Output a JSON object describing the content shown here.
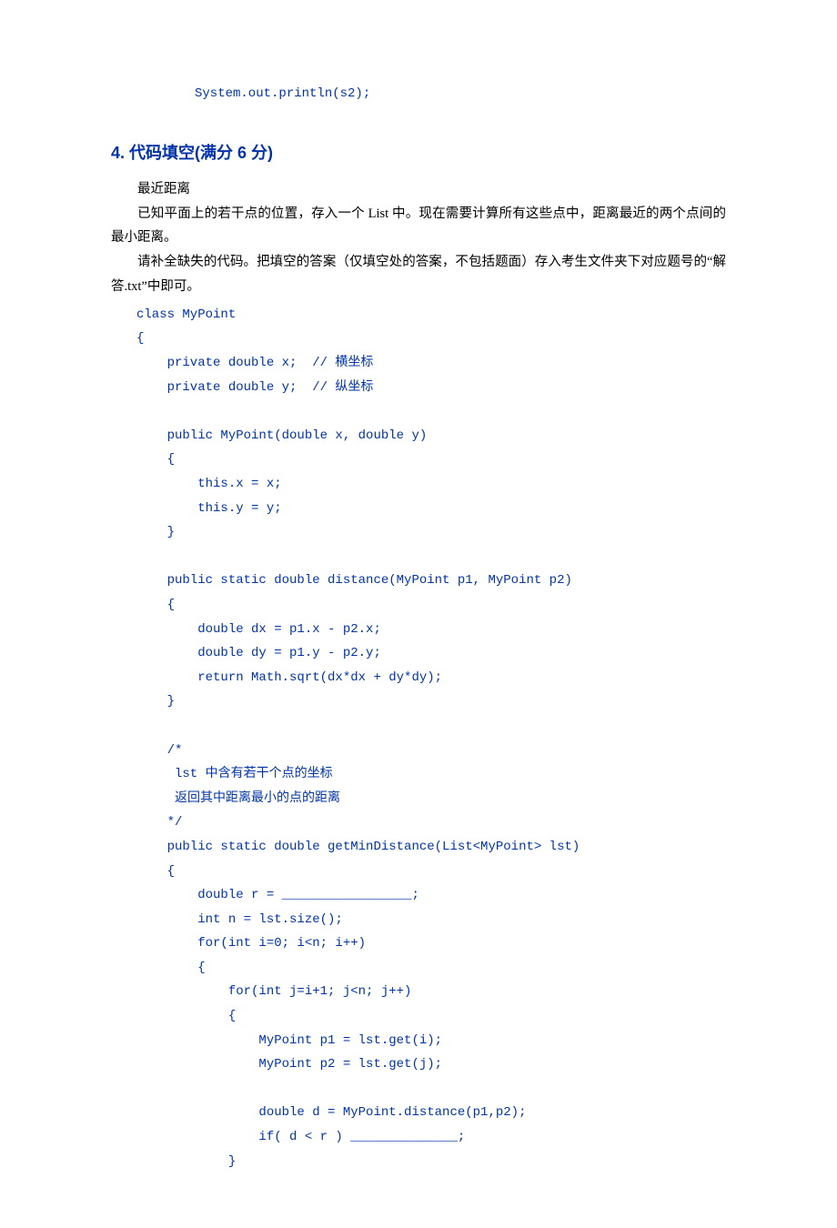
{
  "top_code_line": "System.out.println(s2);",
  "heading": "4. 代码填空(满分 6 分)",
  "para_title": "最近距离",
  "para1": "已知平面上的若干点的位置，存入一个 List 中。现在需要计算所有这些点中，距离最近的两个点间的最小距离。",
  "para2": "请补全缺失的代码。把填空的答案（仅填空处的答案，不包括题面）存入考生文件夹下对应题号的“解答.txt”中即可。",
  "code_lines": [
    "class MyPoint",
    "{",
    "    private double x;  // 横坐标",
    "    private double y;  // 纵坐标",
    "",
    "    public MyPoint(double x, double y)",
    "    {",
    "        this.x = x;",
    "        this.y = y;",
    "    }",
    "",
    "    public static double distance(MyPoint p1, MyPoint p2)",
    "    {",
    "        double dx = p1.x - p2.x;",
    "        double dy = p1.y - p2.y;",
    "        return Math.sqrt(dx*dx + dy*dy);",
    "    }",
    "",
    "    /*",
    "     lst 中含有若干个点的坐标",
    "     返回其中距离最小的点的距离",
    "    */",
    "    public static double getMinDistance(List<MyPoint> lst)",
    "    {",
    "        double r = _________________;",
    "        int n = lst.size();",
    "        for(int i=0; i<n; i++)",
    "        {",
    "            for(int j=i+1; j<n; j++)",
    "            {",
    "                MyPoint p1 = lst.get(i);",
    "                MyPoint p2 = lst.get(j);",
    "",
    "                double d = MyPoint.distance(p1,p2);",
    "                if( d < r ) ______________;",
    "            }"
  ]
}
